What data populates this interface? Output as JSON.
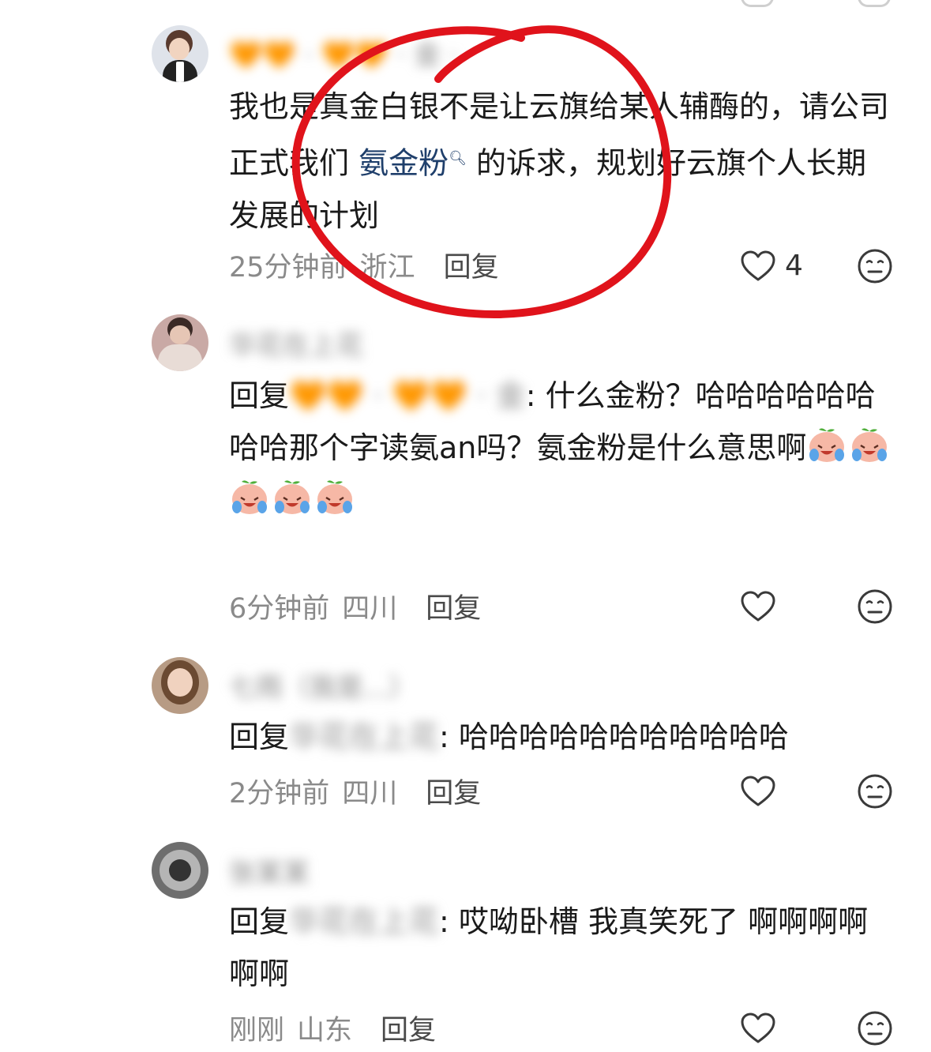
{
  "comments": [
    {
      "username": "🧡🧡 · 🧡🧡 · 金 ·",
      "text_parts": [
        "我也是真金白银不是让云旗给某人辅酶的，请公司正式我们 ",
        "氨金粉",
        " 的诉求，规划好云旗个人长期发展的计划"
      ],
      "time": "25分钟前",
      "location": "浙江",
      "reply_label": "回复",
      "likes": "4"
    },
    {
      "username": "华花在上花",
      "reply_prefix": "回复",
      "reply_target": "🧡🧡 · 🧡🧡 · 金",
      "text": ": 什么金粉？哈哈哈哈哈哈哈哈那个字读氨an吗？氨金粉是什么意思啊",
      "time": "6分钟前",
      "location": "四川",
      "reply_label": "回复",
      "likes": ""
    },
    {
      "username": "七雨（我是...）",
      "reply_prefix": "回复",
      "reply_target": "华花在上花",
      "text": ": 哈哈哈哈哈哈哈哈哈哈哈",
      "time": "2分钟前",
      "location": "四川",
      "reply_label": "回复",
      "likes": ""
    },
    {
      "username": "张某某",
      "reply_prefix": "回复",
      "reply_target": "华花在上花",
      "text": ": 哎呦卧槽 我真笑死了 啊啊啊啊啊啊",
      "time": "刚刚",
      "location": "山东",
      "reply_label": "回复",
      "likes": ""
    }
  ],
  "colors": {
    "annotation_circle": "#e0131b",
    "link": "#1f3f6b",
    "meta": "#8a8a8a"
  },
  "icons": {
    "like": "heart-outline-icon",
    "dislike": "meh-face-icon",
    "emoji": "crying-laughing-peach-emoji",
    "search": "search-icon"
  }
}
